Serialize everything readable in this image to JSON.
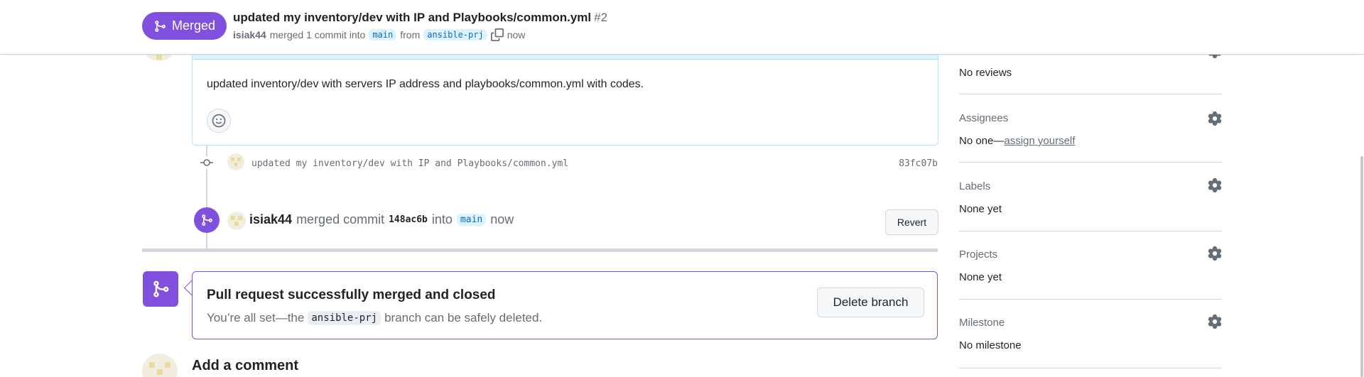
{
  "header": {
    "state_label": "Merged",
    "title": "updated my inventory/dev with IP and Playbooks/common.yml",
    "number": "#2",
    "author": "isiak44",
    "merged_text": "merged 1 commit into",
    "base_branch": "main",
    "from_text": "from",
    "head_branch": "ansible-prj",
    "time": "now"
  },
  "comment": {
    "body": "updated inventory/dev with servers IP address and playbooks/common.yml with codes."
  },
  "timeline": {
    "commit_message": "updated my inventory/dev with IP and Playbooks/common.yml",
    "commit_sha": "83fc07b",
    "merge_actor": "isiak44",
    "merge_text": "merged commit",
    "merge_sha": "148ac6b",
    "merge_into_text": "into",
    "merge_base": "main",
    "merge_time": "now",
    "revert_label": "Revert"
  },
  "merge_status": {
    "heading": "Pull request successfully merged and closed",
    "sub_before": "You’re all set—the",
    "branch": "ansible-prj",
    "sub_after": "branch can be safely deleted.",
    "delete_label": "Delete branch"
  },
  "add_comment": {
    "heading": "Add a comment"
  },
  "sidebar": {
    "reviewers_value": "No reviews",
    "assignees_label": "Assignees",
    "assignees_value": "No one—",
    "assign_yourself": "assign yourself",
    "labels_label": "Labels",
    "labels_value": "None yet",
    "projects_label": "Projects",
    "projects_value": "None yet",
    "milestone_label": "Milestone",
    "milestone_value": "No milestone"
  },
  "colors": {
    "merged_purple": "#8250df",
    "link_blue": "#0969da",
    "muted_text": "#656d76",
    "border": "#d0d7de"
  },
  "icons": [
    "git-merge-icon",
    "copy-icon",
    "smiley-icon",
    "git-commit-icon",
    "gear-icon"
  ]
}
